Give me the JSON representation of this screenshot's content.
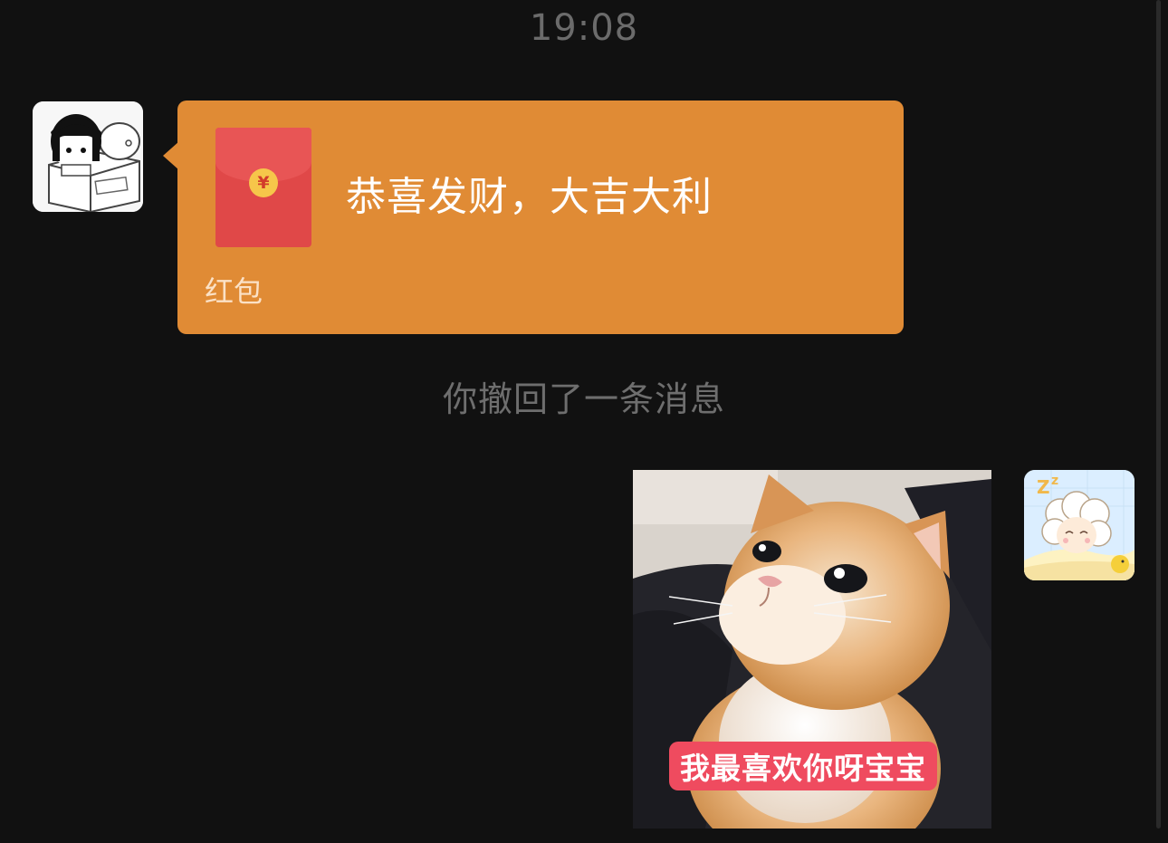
{
  "chat": {
    "timestamp": "19:08",
    "red_packet": {
      "message": "恭喜发财，大吉大利",
      "label": "红包",
      "coin_symbol": "¥",
      "bubble_color": "#e08b35",
      "envelope_color": "#e04848"
    },
    "recall_notice": "你撤回了一条消息",
    "sticker": {
      "caption": "我最喜欢你呀宝宝",
      "caption_color": "#ef4b5f"
    },
    "avatars": {
      "contact_icon": "cartoon-girl-avatar",
      "self_icon": "sleeping-sheep-avatar"
    }
  }
}
